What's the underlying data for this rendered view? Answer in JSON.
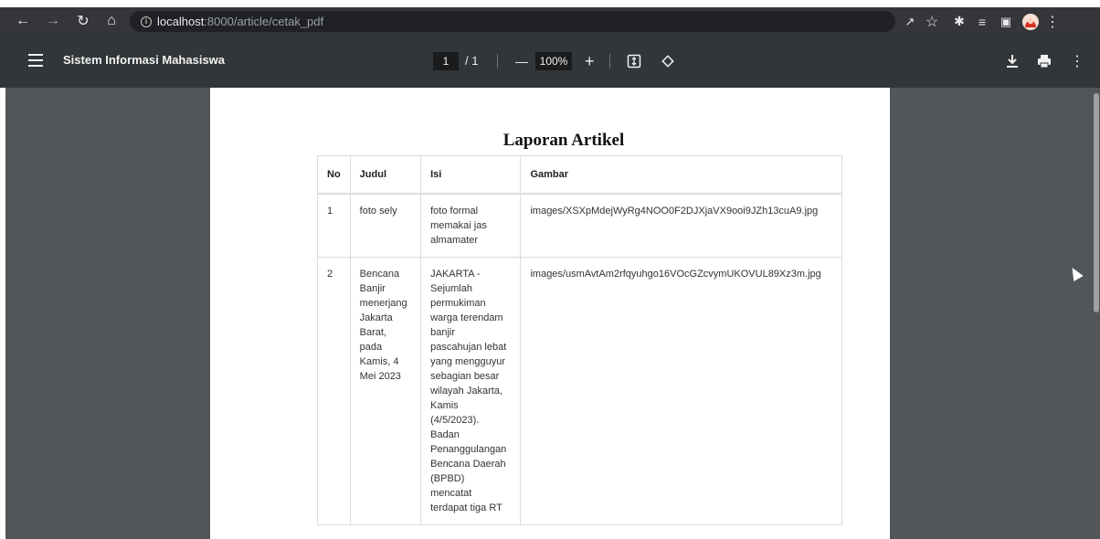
{
  "browser": {
    "url_host": "localhost",
    "url_rest": ":8000/article/cetak_pdf",
    "back_icon": "arrow-left-icon",
    "forward_icon": "arrow-right-icon",
    "reload_icon": "reload-icon",
    "home_icon": "home-icon"
  },
  "pdf_toolbar": {
    "title": "Sistem Informasi Mahasiswa",
    "page_current": "1",
    "page_total": "/ 1",
    "zoom": "100%",
    "zoom_out": "—",
    "zoom_in": "+"
  },
  "document": {
    "title": "Laporan Artikel",
    "columns": [
      "No",
      "Judul",
      "Isi",
      "Gambar"
    ],
    "rows": [
      {
        "no": "1",
        "judul": "foto sely",
        "isi": "foto formal\nmemakai jas\nalmamater",
        "gambar": "images/XSXpMdejWyRg4NOO0F2DJXjaVX9ooi9JZh13cuA9.jpg"
      },
      {
        "no": "2",
        "judul": "Bencana\nBanjir\nmenerjang\nJakarta\nBarat,\npada\nKamis, 4\nMei 2023",
        "isi": "JAKARTA -\nSejumlah\npermukiman\nwarga terendam\nbanjir\npascahujan lebat\nyang mengguyur\nsebagian besar\nwilayah Jakarta,\nKamis\n(4/5/2023).\nBadan\nPenanggulangan\nBencana Daerah\n(BPBD)\nmencatat\nterdapat tiga RT",
        "gambar": "images/usmAvtAm2rfqyuhgo16VOcGZcvymUKOVUL89Xz3m.jpg"
      }
    ]
  }
}
